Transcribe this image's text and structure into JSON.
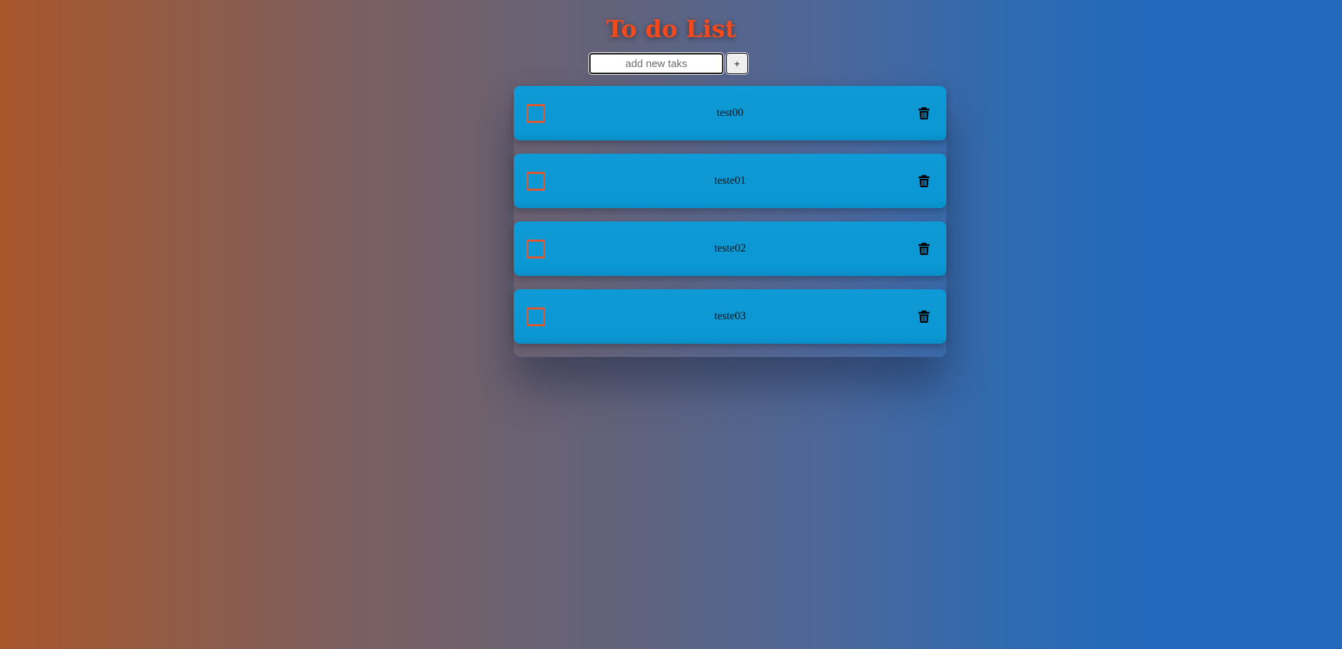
{
  "app": {
    "title": "To do List"
  },
  "new_task": {
    "placeholder": "add new taks",
    "value": "",
    "add_label": "+"
  },
  "tasks": [
    {
      "text": "test00",
      "done": false
    },
    {
      "text": "teste01",
      "done": false
    },
    {
      "text": "teste02",
      "done": false
    },
    {
      "text": "teste03",
      "done": false
    }
  ],
  "icons": {
    "delete": "trash-icon",
    "checkbox": "checkbox-icon"
  },
  "colors": {
    "title": "#f24a1d",
    "task_background": "#0b97d3",
    "checkbox_border": "#e4562b",
    "gradient_left": "#a8562b",
    "gradient_right": "#2269bc"
  }
}
